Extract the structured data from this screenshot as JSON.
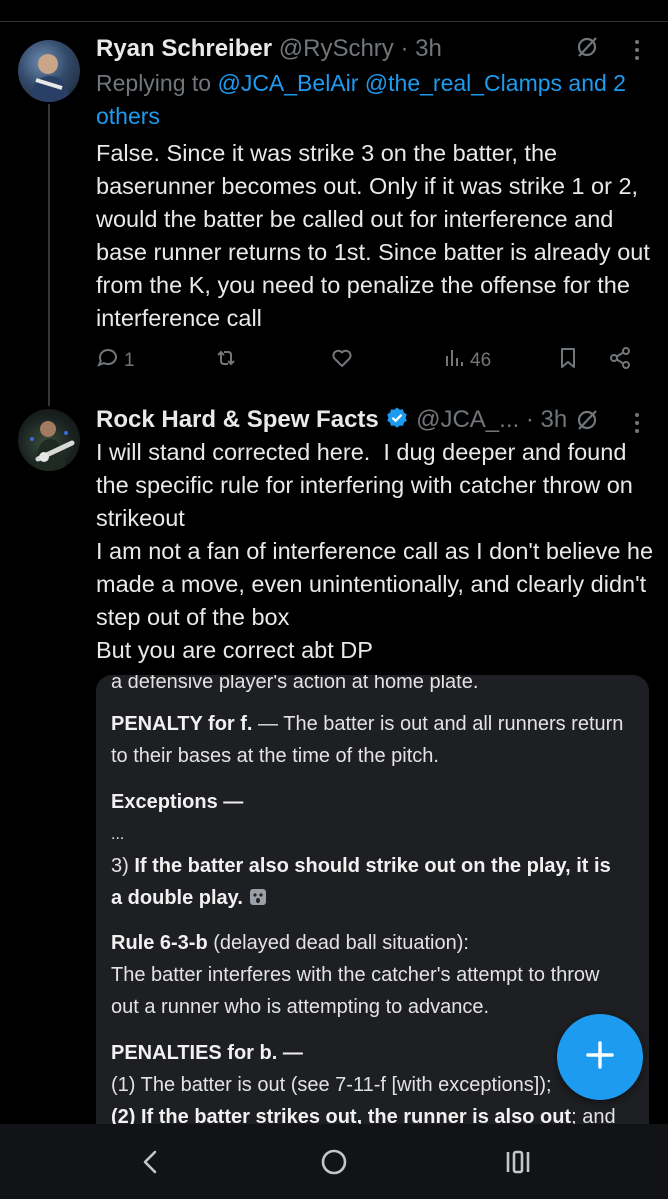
{
  "tweet1": {
    "name": "Ryan Schreiber",
    "handle_time": "@RySchry · 3h",
    "replying_prefix": "Replying to ",
    "replying_mentions": "@JCA_BelAir @the_real_Clamps and 2 others",
    "text": "False. Since it was strike 3 on the batter, the baserunner becomes out. Only if it was strike 1 or 2, would the batter be called out for interference and base runner returns to 1st. Since batter is already out from the K, you need to penalize the offense for the interference call",
    "actions": {
      "reply_count": "1",
      "retweet_count": "",
      "like_count": "",
      "views_count": "46"
    }
  },
  "tweet2": {
    "name": "Rock Hard & Spew Facts",
    "handle": "@JCA_...",
    "time": "· 3h",
    "text": "I will stand corrected here.  I dug deeper and found the specific rule for interfering with catcher throw on strikeout\nI am not a fan of interference call as I don't believe he made a move, even unintentionally, and clearly didn't step out of the box\nBut you are correct abt DP"
  },
  "embed": {
    "top_cut": "a defensive player's action at home plate.",
    "penalty_f_bold": "PENALTY for f.",
    "penalty_f_rest": " — The batter is out and all runners return",
    "penalty_f_rest2": "to their bases at the time of the pitch.",
    "exceptions": "Exceptions —",
    "ellipsis": "...",
    "exc3_prefix": "3) ",
    "exc3_bold1": "If the batter also should strike out on the play, it is",
    "exc3_bold2": "a double play.",
    "rule_bold": "Rule 6-3-b",
    "rule_rest": " (delayed dead ball situation):",
    "rule_line2": "The batter interferes with the catcher's attempt to throw",
    "rule_line3": "out a runner who is attempting to advance.",
    "penalties_b": "PENALTIES for b. —",
    "pen1": "(1) The batter is out (see 7-11-f [with exceptions]);",
    "pen2_bold": "(2) If the batter strikes out, the runner is also out",
    "pen2_rest": "; and"
  },
  "colors": {
    "accent": "#1d9bf0",
    "muted": "#71767b",
    "text": "#e7e9ea",
    "background": "#000000"
  },
  "icons": {
    "reply": "reply-icon",
    "retweet": "retweet-icon",
    "like": "heart-icon",
    "views": "views-icon",
    "bookmark": "bookmark-icon",
    "share": "share-icon",
    "grok": "grok-icon",
    "more": "more-icon",
    "verified": "verified-badge-icon",
    "compose": "plus-icon",
    "nav_back": "back-icon",
    "nav_home": "home-icon",
    "nav_recents": "recents-icon"
  }
}
